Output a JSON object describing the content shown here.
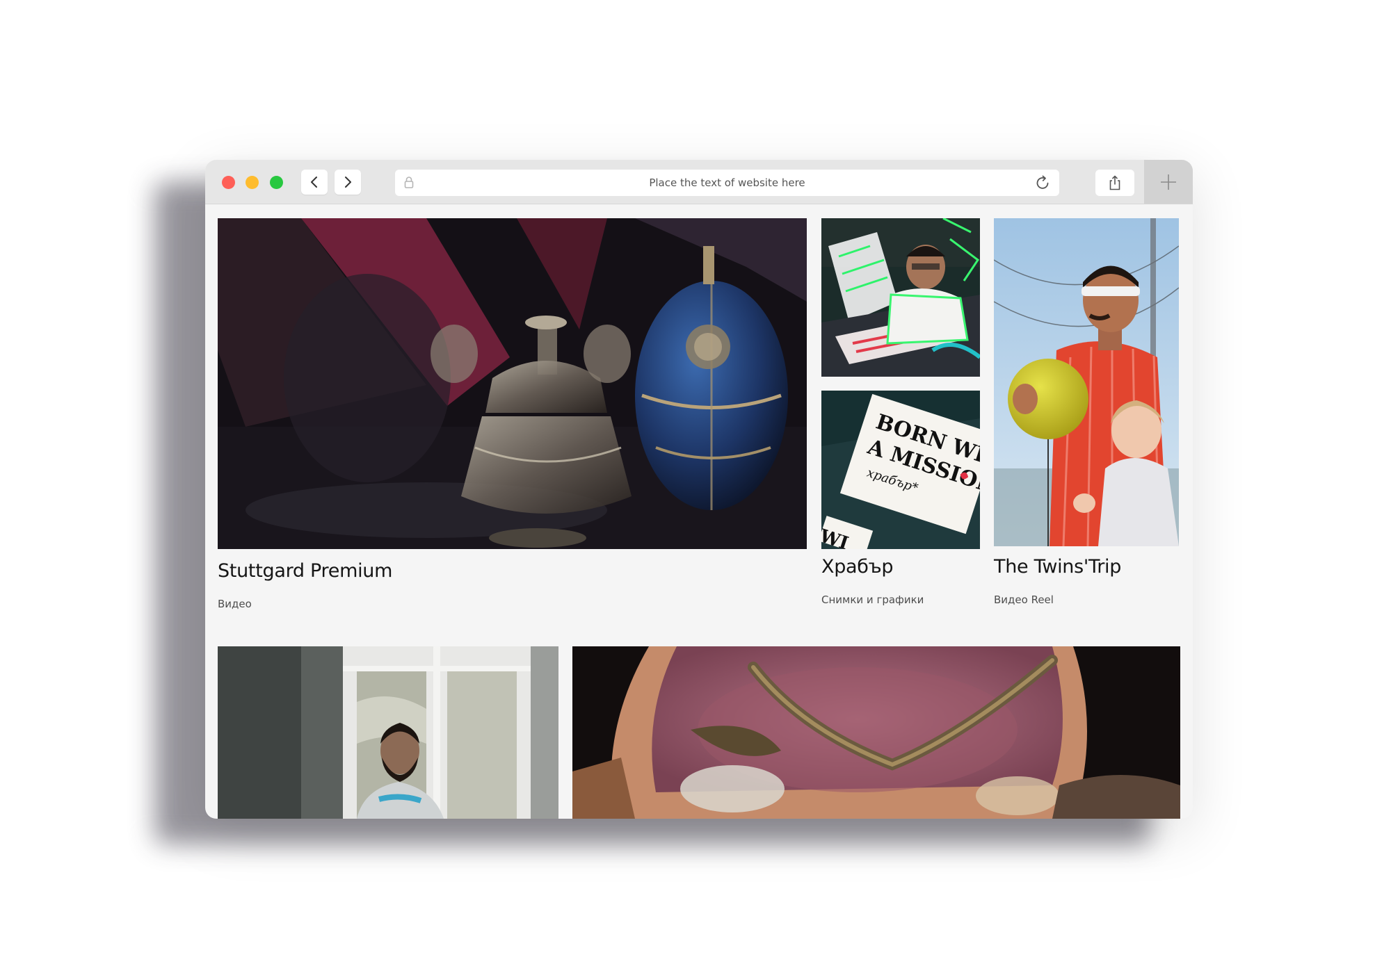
{
  "browser": {
    "address_text": "Place the text of website here",
    "icons": [
      "back-icon",
      "forward-icon",
      "lock-icon",
      "reload-icon",
      "share-icon",
      "new-tab-icon"
    ]
  },
  "portfolio": {
    "items": [
      {
        "title": "Stuttgard Premium",
        "category": "Видео"
      },
      {
        "title": "Храбър",
        "category": "Снимки и графики",
        "image_text": "BORN WITH A MISSION.",
        "image_script": "храбър*"
      },
      {
        "title": "The Twins'Trip",
        "category": "Видео Reel"
      }
    ]
  },
  "colors": {
    "close": "#fe5f57",
    "minimize": "#febc2e",
    "zoom": "#28c840",
    "page_background": "#f5f5f5",
    "title_text": "#151515"
  }
}
